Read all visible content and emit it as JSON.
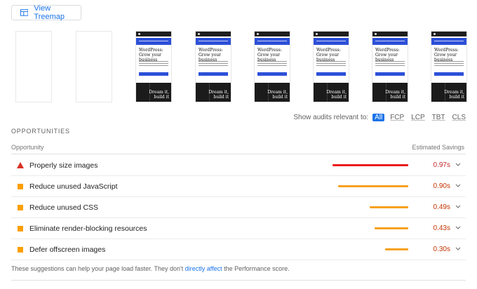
{
  "toolbar": {
    "treemap_label": "View Treemap"
  },
  "filmstrip": {
    "frame_headline": "WordPress: Grow your business",
    "frame_dark_text": "Dream it, build it"
  },
  "filters": {
    "label": "Show audits relevant to:",
    "options": [
      "All",
      "FCP",
      "LCP",
      "TBT",
      "CLS"
    ],
    "selected": "All"
  },
  "opportunities": {
    "section_title": "OPPORTUNITIES",
    "col_opportunity": "Opportunity",
    "col_savings": "Estimated Savings",
    "items": [
      {
        "title": "Properly size images",
        "savings": "0.97s",
        "severity": "fail",
        "value_s": 0.97
      },
      {
        "title": "Reduce unused JavaScript",
        "savings": "0.90s",
        "severity": "average",
        "value_s": 0.9
      },
      {
        "title": "Reduce unused CSS",
        "savings": "0.49s",
        "severity": "average",
        "value_s": 0.49
      },
      {
        "title": "Eliminate render-blocking resources",
        "savings": "0.43s",
        "severity": "average",
        "value_s": 0.43
      },
      {
        "title": "Defer offscreen images",
        "savings": "0.30s",
        "severity": "average",
        "value_s": 0.3
      }
    ]
  },
  "footer": {
    "text_before": "These suggestions can help your page load faster. They don't ",
    "link_text": "directly affect",
    "text_after": " the Performance score."
  },
  "colors": {
    "fail": "#ea1c1c",
    "average": "#f6a11f",
    "link": "#1a73e8"
  }
}
